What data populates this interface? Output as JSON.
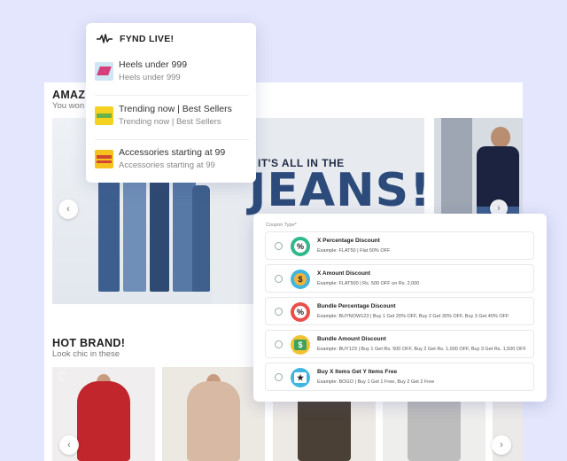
{
  "store": {
    "section1": {
      "title": "AMAZI",
      "subtitle": "You won"
    },
    "banner": {
      "top_text": "IT'S ALL IN THE",
      "big_text": "JEANS!"
    },
    "section2": {
      "title": "HOT BRAND!",
      "subtitle": "Look chic in these"
    },
    "prev_arrow": "‹",
    "next_arrow": "›",
    "heart": "♡"
  },
  "live": {
    "title": "FYND LIVE!",
    "items": [
      {
        "title": "Heels under 999",
        "subtitle": "Heels under 999"
      },
      {
        "title": "Trending now | Best Sellers",
        "subtitle": "Trending now | Best Sellers"
      },
      {
        "title": "Accessories starting at 99",
        "subtitle": "Accessories starting at 99"
      }
    ]
  },
  "coupon": {
    "label": "Coupon Type*",
    "options": [
      {
        "title": "X Percentage Discount",
        "example": "Example: FLAT50  |  Flat 50% OFF",
        "icon": "%"
      },
      {
        "title": "X Amount Discount",
        "example": "Example: FLAT500  |  Rs. 500 OFF on Rs. 2,000",
        "icon": "$"
      },
      {
        "title": "Bundle Percentage Discount",
        "example": "Example: BUYNOW123  |  Buy 1 Get 20% OFF, Buy 2 Get 30% OFF, Buy 3 Get 40% OFF",
        "icon": "%"
      },
      {
        "title": "Bundle Amount Discount",
        "example": "Example: BUY123  |  Buy 1 Get Rs. 500 OFF, Buy 2 Get Rs. 1,000 OFF, Buy 3 Get Rs. 1,500 OFF",
        "icon": "$"
      },
      {
        "title": "Buy X Items Get Y Items Free",
        "example": "Example: BOGO  |  Buy 1 Get 1 Free, Buy 2 Get 2 Free",
        "icon": "★"
      }
    ]
  }
}
